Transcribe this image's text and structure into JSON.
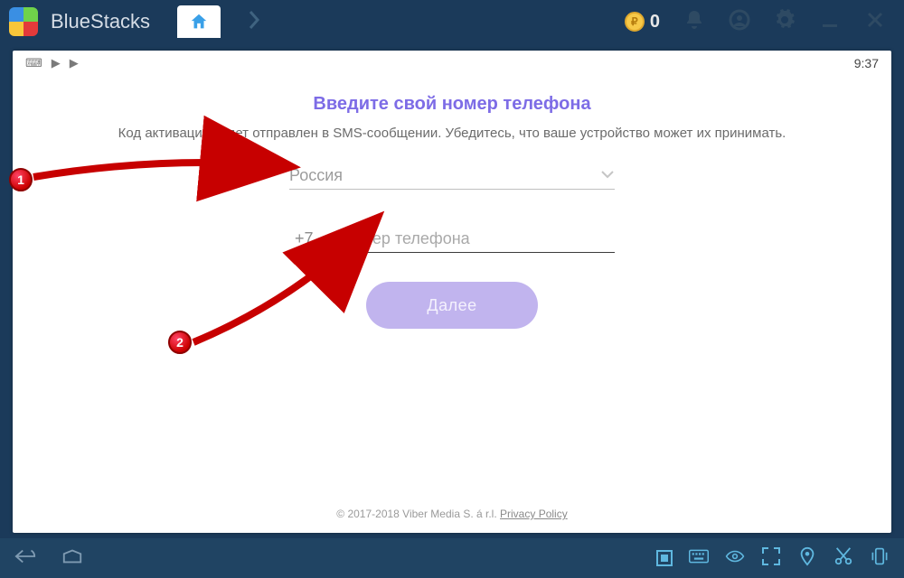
{
  "titlebar": {
    "brand": "BlueStacks",
    "coin_value": "0"
  },
  "statusbar": {
    "clock": "9:37"
  },
  "page": {
    "heading": "Введите свой номер телефона",
    "subtext": "Код активации будет отправлен в SMS-сообщении. Убедитесь, что ваше устройство может их принимать.",
    "country": "Россия",
    "dial_code": "+7",
    "phone_placeholder": "Номер телефона",
    "next_label": "Далее",
    "footer_pre": "© 2017-2018 Viber Media S. á r.l. ",
    "footer_link": "Privacy Policy"
  },
  "annotations": {
    "badge1": "1",
    "badge2": "2"
  }
}
